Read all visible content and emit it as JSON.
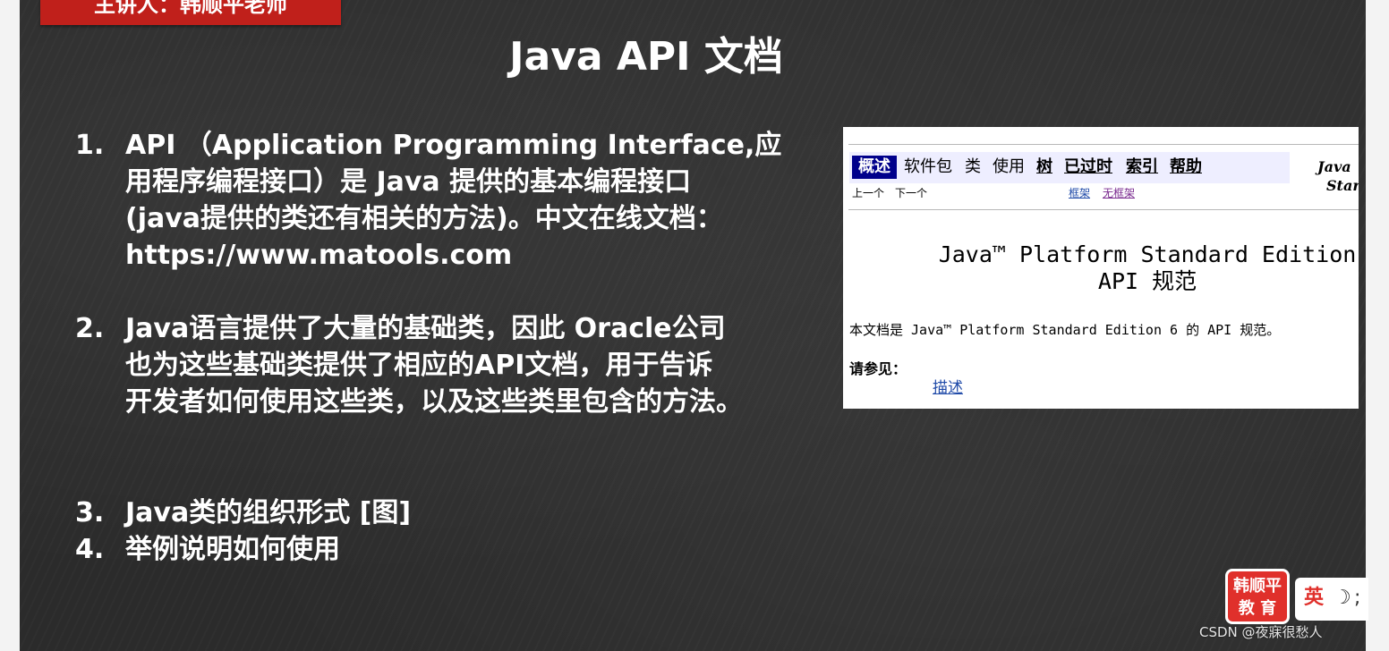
{
  "lecturer_banner": "主讲人：韩顺平老师",
  "title": "Java API 文档",
  "points": [
    {
      "num": "1.",
      "lines": [
        "API （Application Programming Interface,应",
        "用程序编程接口）是 Java 提供的基本编程接口",
        "(java提供的类还有相关的方法)。中文在线文档：",
        "https://www.matools.com"
      ]
    },
    {
      "num": "2.",
      "lines": [
        "Java语言提供了大量的基础类，因此 Oracle公司",
        "也为这些基础类提供了相应的API文档，用于告诉",
        "开发者如何使用这些类，以及这些类里包含的方法。"
      ]
    },
    {
      "num": "3.",
      "lines": [
        "Java类的组织形式 [图]"
      ]
    },
    {
      "num": "4.",
      "lines": [
        "举例说明如何使用"
      ]
    }
  ],
  "doc": {
    "nav": [
      "概述",
      "软件包",
      "类",
      "使用",
      "树",
      "已过时",
      "索引",
      "帮助"
    ],
    "brand_lines": [
      "Java",
      "Star"
    ],
    "subnav": {
      "prev": "上一个",
      "next": "下一个",
      "frames": "框架",
      "no_frames": "无框架"
    },
    "heading_lines": [
      "Java™ Platform Standard Edition",
      "API 规范"
    ],
    "description": "本文档是 Java™ Platform Standard Edition 6 的 API 规范。",
    "see_also": "请参见：",
    "see_also_link": "描述"
  },
  "logo_lines": [
    "韩顺平",
    "教 育"
  ],
  "lang_label": "英",
  "semicolon": ";",
  "watermark": "CSDN @夜寐很愁人",
  "colors": {
    "banner": "#c0201b",
    "slide_bg": "#2b2b2b",
    "nav_active_bg": "#00008b",
    "nav_bar_bg": "#eeeeff",
    "link": "#1f4aa8",
    "logo_red": "#e0302b"
  }
}
